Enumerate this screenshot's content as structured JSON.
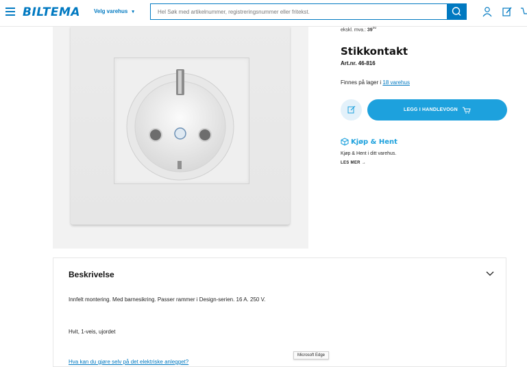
{
  "header": {
    "logo": "BILTEMA",
    "store_select": "Velg varehus",
    "store_chevron": "▾",
    "search_placeholder": "Hel Søk med artikelnummer, registreringsnummer eller fritekst.",
    "icons": [
      "menu-icon",
      "search-icon",
      "user-icon",
      "edit-icon",
      "cart-icon"
    ]
  },
  "product": {
    "price_label": "ekskl. mva.: ",
    "price_value": "39",
    "price_cents": "60",
    "title": "Stikkontakt",
    "art_nr": "Art.nr. 46-816",
    "stock_prefix": "Finnes på lager i ",
    "stock_link": "18 varehus",
    "add_to_cart": "LEGG I HANDLEVOGN"
  },
  "kjop_hent": {
    "title": "Kjøp & Hent",
    "text": "Kjøp & Hent i ditt varehus.",
    "more": "LES MER",
    "more_arrow": "→"
  },
  "description": {
    "heading": "Beskrivelse",
    "paragraph1": "Innfelt montering. Med barnesikring. Passer rammer i Design-serien. 16 A. 250 V.",
    "paragraph2": "Hvit, 1-veis, ujordet",
    "link": "Hva kan du gjøre selv på det elektriske anlegget?"
  },
  "tooltip": "Microsoft Edge",
  "colors": {
    "brand": "#0079c1",
    "accent": "#1da1dd",
    "light": "#e3f1fa"
  }
}
